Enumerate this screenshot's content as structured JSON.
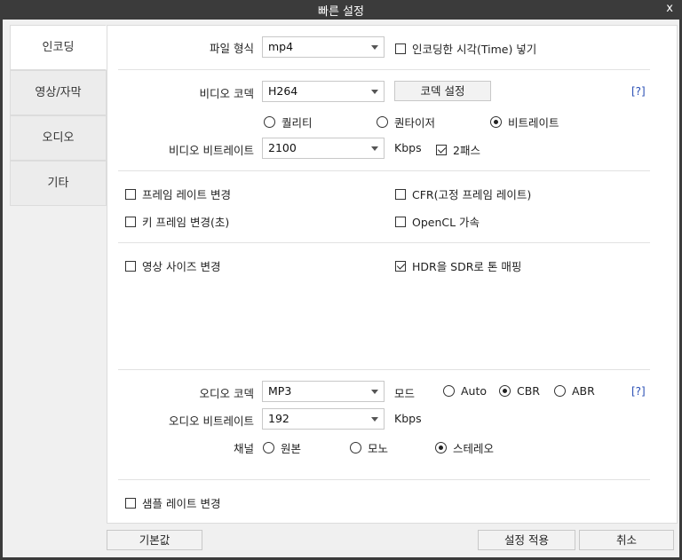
{
  "window": {
    "title": "빠른 설정",
    "close_label": "x"
  },
  "tabs": [
    {
      "label": "인코딩"
    },
    {
      "label": "영상/자막"
    },
    {
      "label": "오디오"
    },
    {
      "label": "기타"
    }
  ],
  "encoding": {
    "file_format_label": "파일 형식",
    "file_format_value": "mp4",
    "insert_time_label": "인코딩한 시각(Time) 넣기",
    "insert_time_checked": false
  },
  "video": {
    "codec_label": "비디오 코덱",
    "codec_value": "H264",
    "codec_settings_button": "코덱 설정",
    "help_label": "[?]",
    "mode_options": [
      "퀄리티",
      "퀀타이저",
      "비트레이트"
    ],
    "mode_selected": "비트레이트",
    "bitrate_label": "비디오 비트레이트",
    "bitrate_value": "2100",
    "bitrate_unit": "Kbps",
    "two_pass_label": "2패스",
    "two_pass_checked": true
  },
  "frame": {
    "change_frame_rate_label": "프레임 레이트 변경",
    "cfr_label": "CFR(고정 프레임 레이트)",
    "keyframe_label": "키 프레임 변경(초)",
    "opencl_label": "OpenCL 가속"
  },
  "size": {
    "change_size_label": "영상 사이즈 변경",
    "hdr_label": "HDR을 SDR로 톤 매핑",
    "hdr_checked": true
  },
  "audio": {
    "codec_label": "오디오 코덱",
    "codec_value": "MP3",
    "mode_label": "모드",
    "mode_options": [
      "Auto",
      "CBR",
      "ABR"
    ],
    "mode_selected": "CBR",
    "help_label": "[?]",
    "bitrate_label": "오디오 비트레이트",
    "bitrate_value": "192",
    "bitrate_unit": "Kbps",
    "channel_label": "채널",
    "channel_options": [
      "원본",
      "모노",
      "스테레오"
    ],
    "channel_selected": "스테레오",
    "sample_rate_label": "샘플 레이트 변경"
  },
  "footer": {
    "default_button": "기본값",
    "apply_button": "설정 적용",
    "cancel_button": "취소"
  }
}
